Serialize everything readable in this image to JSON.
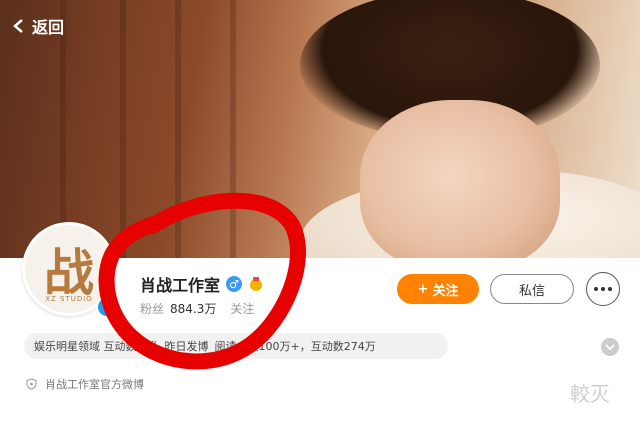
{
  "nav": {
    "back_label": "返回"
  },
  "profile": {
    "avatar_char": "战",
    "avatar_sub": "XZ STUDIO",
    "name": "肖战工作室",
    "fans_label": "粉丝",
    "fans_count": "884.3万",
    "follow_label": "关注",
    "description": "肖战工作室官方微博"
  },
  "actions": {
    "follow_button": "关注",
    "follow_plus": "+",
    "message_button": "私信"
  },
  "tags": {
    "text_1": "娱乐明星领域 互动数飙升",
    "text_2": "昨日发博",
    "text_3": "阅读人数100万+，互动数274万"
  },
  "watermark": "較灭",
  "colors": {
    "accent": "#ff8200",
    "verify_blue": "#1f9cf0",
    "annotation_red": "#e60000"
  },
  "icons": [
    "back-chevron-icon",
    "verified-badge-icon",
    "male-gender-icon",
    "medal-icon",
    "more-dots-icon",
    "shield-icon",
    "chevron-down-icon"
  ]
}
